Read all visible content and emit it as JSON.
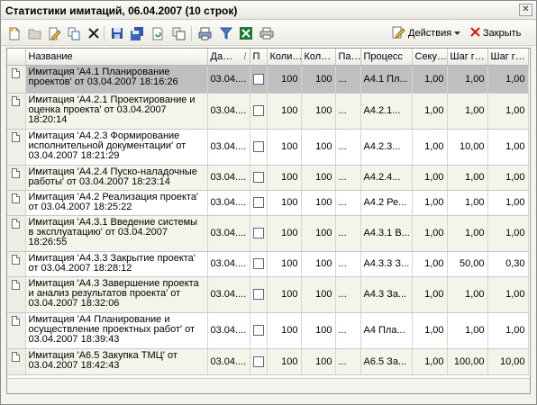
{
  "window": {
    "title": "Статистики имитаций, 06.04.2007 (10 строк)",
    "close_glyph": "✕"
  },
  "toolbar": {
    "icons": [
      "new-icon",
      "open-folder-icon",
      "edit-icon",
      "copy-icon",
      "delete-icon",
      "save-icon",
      "save-all-icon",
      "refresh-icon",
      "copy-all-icon",
      "print-settings-icon",
      "filter-icon",
      "excel-icon",
      "print-icon"
    ],
    "actions_label": "Действия",
    "close_label": "Закрыть"
  },
  "grid": {
    "columns": [
      "",
      "Название",
      "Да…",
      "П",
      "Коли…",
      "Кол…",
      "Па…",
      "Процесс",
      "Секу…",
      "Шаг г…",
      "Шаг г…"
    ],
    "sort_indicator": "/",
    "rows": [
      {
        "name": "Имитация 'А4.1 Планирование проектов' от 03.04.2007 18:16:26",
        "date": "03.04....",
        "c1": "100",
        "c2": "100",
        "c3": "...",
        "process": "А4.1 Пл...",
        "sec": "1,00",
        "s1": "1,00",
        "s2": "1,00"
      },
      {
        "name": "Имитация 'А4.2.1 Проектирование и оценка проекта' от 03.04.2007 18:20:14",
        "date": "03.04....",
        "c1": "100",
        "c2": "100",
        "c3": "...",
        "process": "А4.2.1...",
        "sec": "1,00",
        "s1": "1,00",
        "s2": "1,00"
      },
      {
        "name": "Имитация 'А4.2.3 Формирование исполнительной документации' от 03.04.2007 18:21:29",
        "date": "03.04....",
        "c1": "100",
        "c2": "100",
        "c3": "...",
        "process": "А4.2.3...",
        "sec": "1,00",
        "s1": "10,00",
        "s2": "1,00"
      },
      {
        "name": "Имитация 'А4.2.4 Пуско-наладочные работы' от 03.04.2007 18:23:14",
        "date": "03.04....",
        "c1": "100",
        "c2": "100",
        "c3": "...",
        "process": "А4.2.4...",
        "sec": "1,00",
        "s1": "1,00",
        "s2": "1,00"
      },
      {
        "name": "Имитация 'А4.2 Реализация проекта' от 03.04.2007 18:25:22",
        "date": "03.04....",
        "c1": "100",
        "c2": "100",
        "c3": "...",
        "process": "А4.2 Ре...",
        "sec": "1,00",
        "s1": "1,00",
        "s2": "1,00"
      },
      {
        "name": "Имитация 'А4.3.1 Введение системы в эксплуатацию' от 03.04.2007 18:26:55",
        "date": "03.04....",
        "c1": "100",
        "c2": "100",
        "c3": "...",
        "process": "А4.3.1 В...",
        "sec": "1,00",
        "s1": "1,00",
        "s2": "1,00"
      },
      {
        "name": "Имитация 'А4.3.3 Закрытие проекта' от 03.04.2007 18:28:12",
        "date": "03.04....",
        "c1": "100",
        "c2": "100",
        "c3": "...",
        "process": "А4.3.3 З...",
        "sec": "1,00",
        "s1": "50,00",
        "s2": "0,30"
      },
      {
        "name": "Имитация 'А4.3 Завершение проекта и анализ результатов проекта' от 03.04.2007 18:32:06",
        "date": "03.04....",
        "c1": "100",
        "c2": "100",
        "c3": "...",
        "process": "А4.3 За...",
        "sec": "1,00",
        "s1": "1,00",
        "s2": "1,00"
      },
      {
        "name": "Имитация 'А4 Планирование и осуществление проектных работ' от 03.04.2007 18:39:43",
        "date": "03.04....",
        "c1": "100",
        "c2": "100",
        "c3": "...",
        "process": "А4 Пла...",
        "sec": "1,00",
        "s1": "1,00",
        "s2": "1,00"
      },
      {
        "name": "Имитация 'А6.5 Закупка ТМЦ' от 03.04.2007 18:42:43",
        "date": "03.04....",
        "c1": "100",
        "c2": "100",
        "c3": "...",
        "process": "А6.5 За...",
        "sec": "1,00",
        "s1": "100,00",
        "s2": "10,00"
      }
    ]
  },
  "colors": {
    "selected_row": "#bfbfbf",
    "alt_row": "#f5f4ea",
    "grid_border": "#c9c8c2"
  }
}
